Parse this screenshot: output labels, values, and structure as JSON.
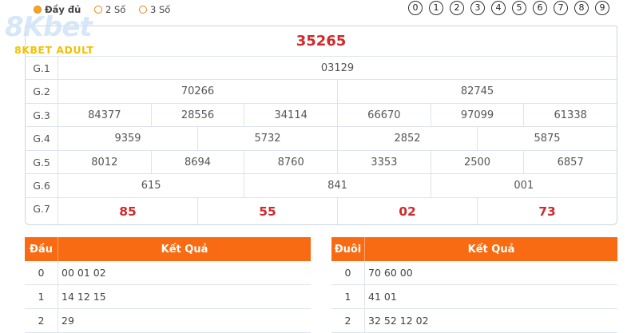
{
  "options": [
    {
      "label": "Đầy đủ",
      "checked": true
    },
    {
      "label": "2 Số",
      "checked": false
    },
    {
      "label": "3 Số",
      "checked": false
    }
  ],
  "digits": [
    "0",
    "1",
    "2",
    "3",
    "4",
    "5",
    "6",
    "7",
    "8",
    "9"
  ],
  "watermark": {
    "line1": "8Kbet",
    "line2": "8KBET ADULT"
  },
  "results": {
    "special": "35265",
    "rows": [
      {
        "label": "G.1",
        "values": [
          "03129"
        ]
      },
      {
        "label": "G.2",
        "values": [
          "70266",
          "82745"
        ]
      },
      {
        "label": "G.3",
        "values": [
          "84377",
          "28556",
          "34114",
          "66670",
          "97099",
          "61338"
        ]
      },
      {
        "label": "G.4",
        "values": [
          "9359",
          "5732",
          "2852",
          "5875"
        ]
      },
      {
        "label": "G.5",
        "values": [
          "8012",
          "8694",
          "8760",
          "3353",
          "2500",
          "6857"
        ]
      },
      {
        "label": "G.6",
        "values": [
          "615",
          "841",
          "001"
        ]
      },
      {
        "label": "G.7",
        "values": [
          "85",
          "55",
          "02",
          "73"
        ]
      }
    ]
  },
  "dau_table": {
    "head_col1": "Đầu",
    "head_col2": "Kết Quả",
    "rows": [
      {
        "key": "0",
        "value": "00 01 02"
      },
      {
        "key": "1",
        "value": "14 12 15"
      },
      {
        "key": "2",
        "value": "29"
      }
    ]
  },
  "duoi_table": {
    "head_col1": "Đuôi",
    "head_col2": "Kết Quả",
    "rows": [
      {
        "key": "0",
        "value": "70 60 00"
      },
      {
        "key": "1",
        "value": "41 01"
      },
      {
        "key": "2",
        "value": "32 52 12 02"
      }
    ]
  }
}
